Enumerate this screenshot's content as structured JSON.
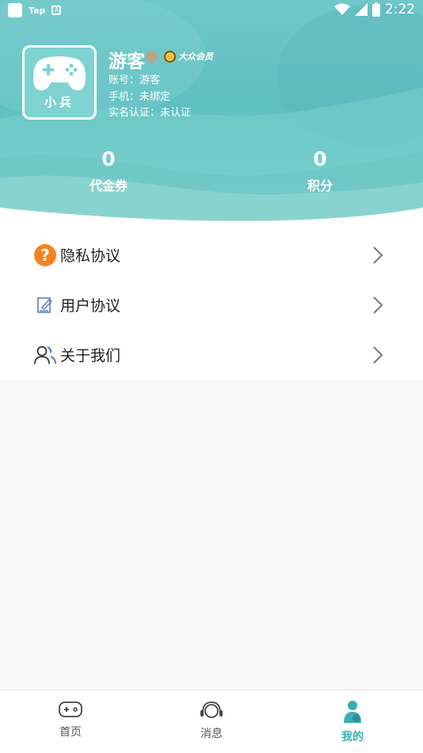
{
  "status_bar": {
    "app_label": "Tap",
    "time": "2:22"
  },
  "profile": {
    "avatar_label": "小兵",
    "name": "游客",
    "member_badge": "大众会员",
    "account": "账号：游客",
    "phone": "手机：未绑定",
    "verification": "实名认证：未认证"
  },
  "stats": [
    {
      "value": "0",
      "label": "代金券"
    },
    {
      "value": "0",
      "label": "积分"
    }
  ],
  "menu": [
    {
      "label": "隐私协议",
      "icon": "question-icon"
    },
    {
      "label": "用户协议",
      "icon": "edit-document-icon"
    },
    {
      "label": "关于我们",
      "icon": "users-icon"
    }
  ],
  "tabs": [
    {
      "label": "首页",
      "icon": "gamepad-icon",
      "active": false
    },
    {
      "label": "消息",
      "icon": "headset-icon",
      "active": false
    },
    {
      "label": "我的",
      "icon": "user-icon",
      "active": true
    }
  ],
  "colors": {
    "accent": "#3aaeb2",
    "header": "#6fc7c9",
    "question": "#f5821f"
  }
}
